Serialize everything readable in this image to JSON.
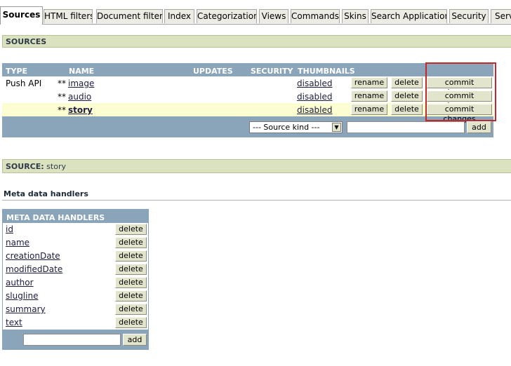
{
  "tabs": [
    {
      "label": "Sources",
      "active": true
    },
    {
      "label": "HTML filters"
    },
    {
      "label": "Document filters"
    },
    {
      "label": "Index"
    },
    {
      "label": "Categorization"
    },
    {
      "label": "Views"
    },
    {
      "label": "Commands"
    },
    {
      "label": "Skins"
    },
    {
      "label": "Search Applications"
    },
    {
      "label": "Security"
    },
    {
      "label": "Serv"
    }
  ],
  "sources_section": {
    "title": "SOURCES"
  },
  "sources_table": {
    "headers": {
      "type": "TYPE",
      "name": "NAME",
      "updates": "UPDATES",
      "security": "SECURITY",
      "thumbnails": "THUMBNAILS"
    },
    "rows": [
      {
        "type": "Push API",
        "marker": "**",
        "name": "image",
        "thumbnails": "disabled",
        "rename": "rename",
        "delete": "delete",
        "commit": "commit changes"
      },
      {
        "type": "",
        "marker": "**",
        "name": "audio",
        "thumbnails": "disabled",
        "rename": "rename",
        "delete": "delete",
        "commit": "commit changes"
      },
      {
        "type": "",
        "marker": "**",
        "name": "story",
        "thumbnails": "disabled",
        "rename": "rename",
        "delete": "delete",
        "commit": "commit changes",
        "selected": true
      }
    ],
    "source_kind": {
      "selected": "--- Source kind ---"
    },
    "add_label": "add"
  },
  "source_section": {
    "label": "SOURCE:",
    "value": "story"
  },
  "meta_handlers": {
    "heading": "Meta data handlers",
    "table_header": "META DATA HANDLERS",
    "items": [
      "id",
      "name",
      "creationDate",
      "modifiedDate",
      "author",
      "slugline",
      "summary",
      "text"
    ],
    "delete_label": "delete",
    "add_label": "add"
  },
  "colors": {
    "accent_bar": "#dbe2bf",
    "table_header": "#8aa4b9",
    "selected_row": "#fdfdd2",
    "highlight": "#c62828"
  }
}
